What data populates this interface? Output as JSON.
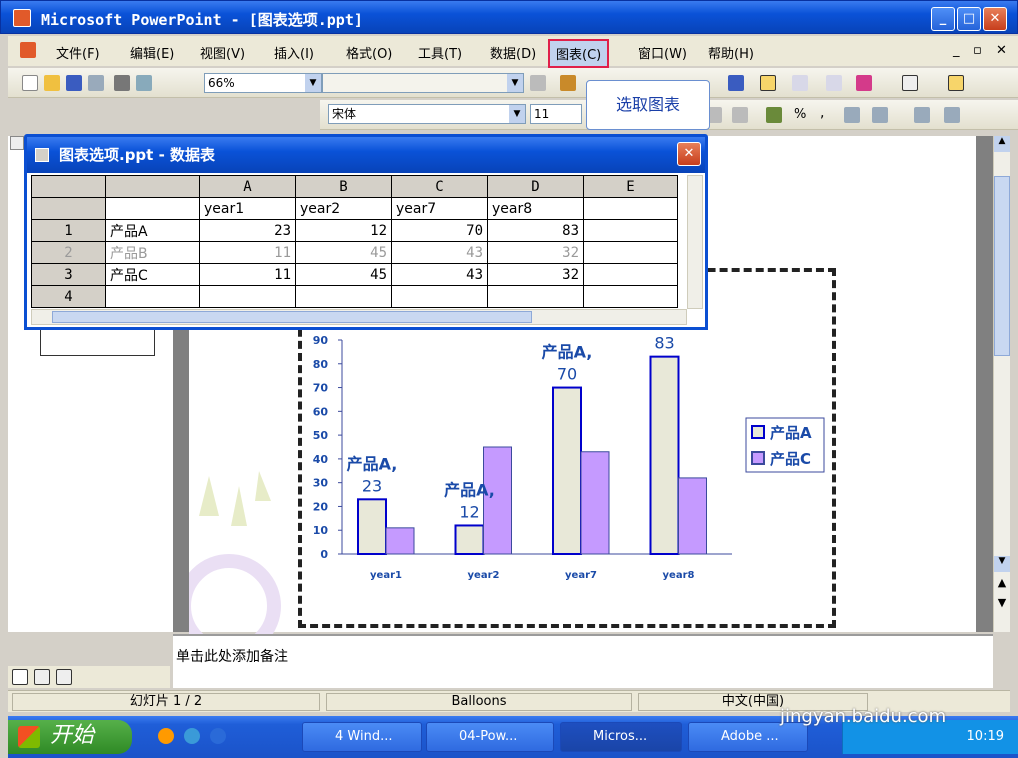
{
  "window": {
    "title": "Microsoft PowerPoint - [图表选项.ppt]",
    "min": "_",
    "max": "□",
    "close": "✕"
  },
  "menus": [
    "文件(F)",
    "编辑(E)",
    "视图(V)",
    "插入(I)",
    "格式(O)",
    "工具(T)",
    "数据(D)",
    "图表(C)",
    "窗口(W)",
    "帮助(H)"
  ],
  "toolbar": {
    "zoom": "66%",
    "font": "宋体",
    "size": "11"
  },
  "balloon": {
    "text": "选取图表"
  },
  "datasheet": {
    "title": "图表选项.ppt - 数据表",
    "columns": [
      "A",
      "B",
      "C",
      "D",
      "E"
    ],
    "header_row": [
      "year1",
      "year2",
      "year7",
      "year8",
      ""
    ],
    "rows": [
      {
        "num": "1",
        "label": "产品A",
        "values": [
          "23",
          "12",
          "70",
          "83"
        ]
      },
      {
        "num": "2",
        "label": "产品B",
        "values": [
          "11",
          "45",
          "43",
          "32"
        ]
      },
      {
        "num": "3",
        "label": "产品C",
        "values": [
          "11",
          "45",
          "43",
          "32"
        ]
      },
      {
        "num": "4",
        "label": "",
        "values": [
          "",
          "",
          "",
          ""
        ]
      }
    ]
  },
  "chart_data": {
    "type": "bar",
    "categories": [
      "year1",
      "year2",
      "year7",
      "year8"
    ],
    "series": [
      {
        "name": "产品A",
        "values": [
          23,
          12,
          70,
          83
        ],
        "color": "#e8e8d8",
        "stroke": "#0000cc"
      },
      {
        "name": "产品C",
        "values": [
          11,
          45,
          43,
          32
        ],
        "color": "#c59aff",
        "stroke": "#3b4a9c"
      }
    ],
    "ylim": [
      0,
      90
    ],
    "yticks": [
      "0",
      "10",
      "20",
      "30",
      "40",
      "50",
      "60",
      "70",
      "80",
      "90"
    ],
    "data_labels": [
      {
        "series": "产品A",
        "category": "year1",
        "text": "产品A,",
        "value": "23"
      },
      {
        "series": "产品A",
        "category": "year2",
        "text": "产品A,",
        "value": "12"
      },
      {
        "series": "产品A",
        "category": "year7",
        "text": "产品A,",
        "value": "70"
      },
      {
        "series": "产品A",
        "category": "year8",
        "text": "",
        "value": "83"
      }
    ],
    "legend": {
      "placement": "right",
      "items": [
        "产品A",
        "产品C"
      ]
    }
  },
  "notes": {
    "placeholder": "单击此处添加备注"
  },
  "status": {
    "slide": "幻灯片 1 / 2",
    "design": "Balloons",
    "lang": "中文(中国)"
  },
  "taskbar": {
    "start": "开始",
    "tasks": [
      "4 Wind...",
      "04-Pow...",
      "Micros...",
      "Adobe ..."
    ],
    "time": "10:19"
  },
  "watermark": {
    "site": "jingyan.baidu.com"
  }
}
